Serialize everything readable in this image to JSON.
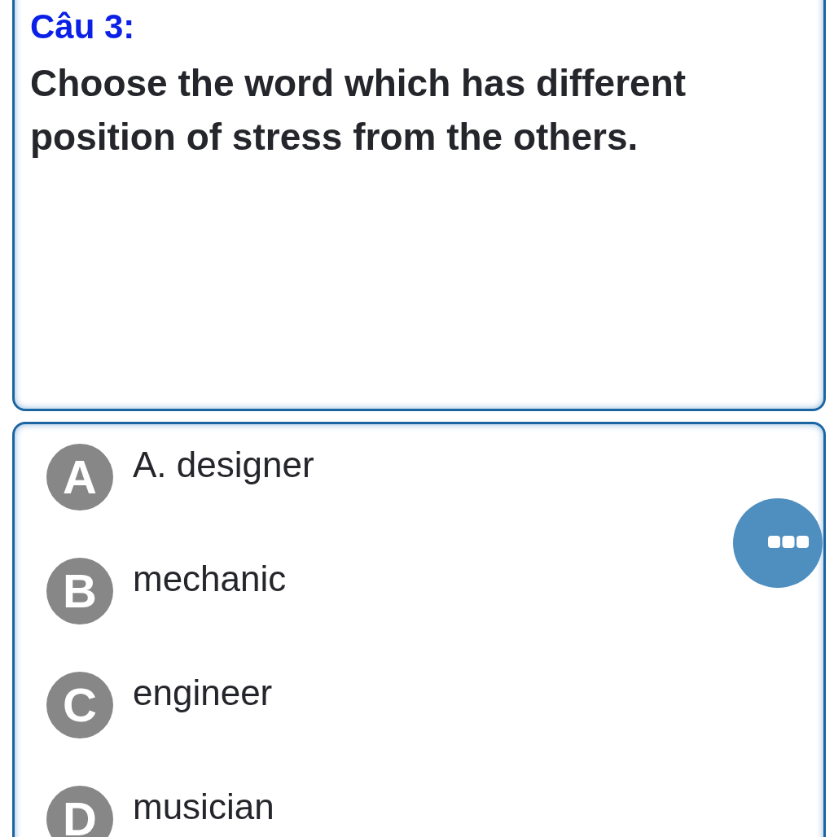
{
  "question": {
    "label": "Câu 3:",
    "text": "Choose the word which has different position of stress from the others."
  },
  "options": [
    {
      "letter": "A",
      "text": "A. designer"
    },
    {
      "letter": "B",
      "text": "mechanic"
    },
    {
      "letter": "C",
      "text": "engineer"
    },
    {
      "letter": "D",
      "text": "musician"
    }
  ]
}
